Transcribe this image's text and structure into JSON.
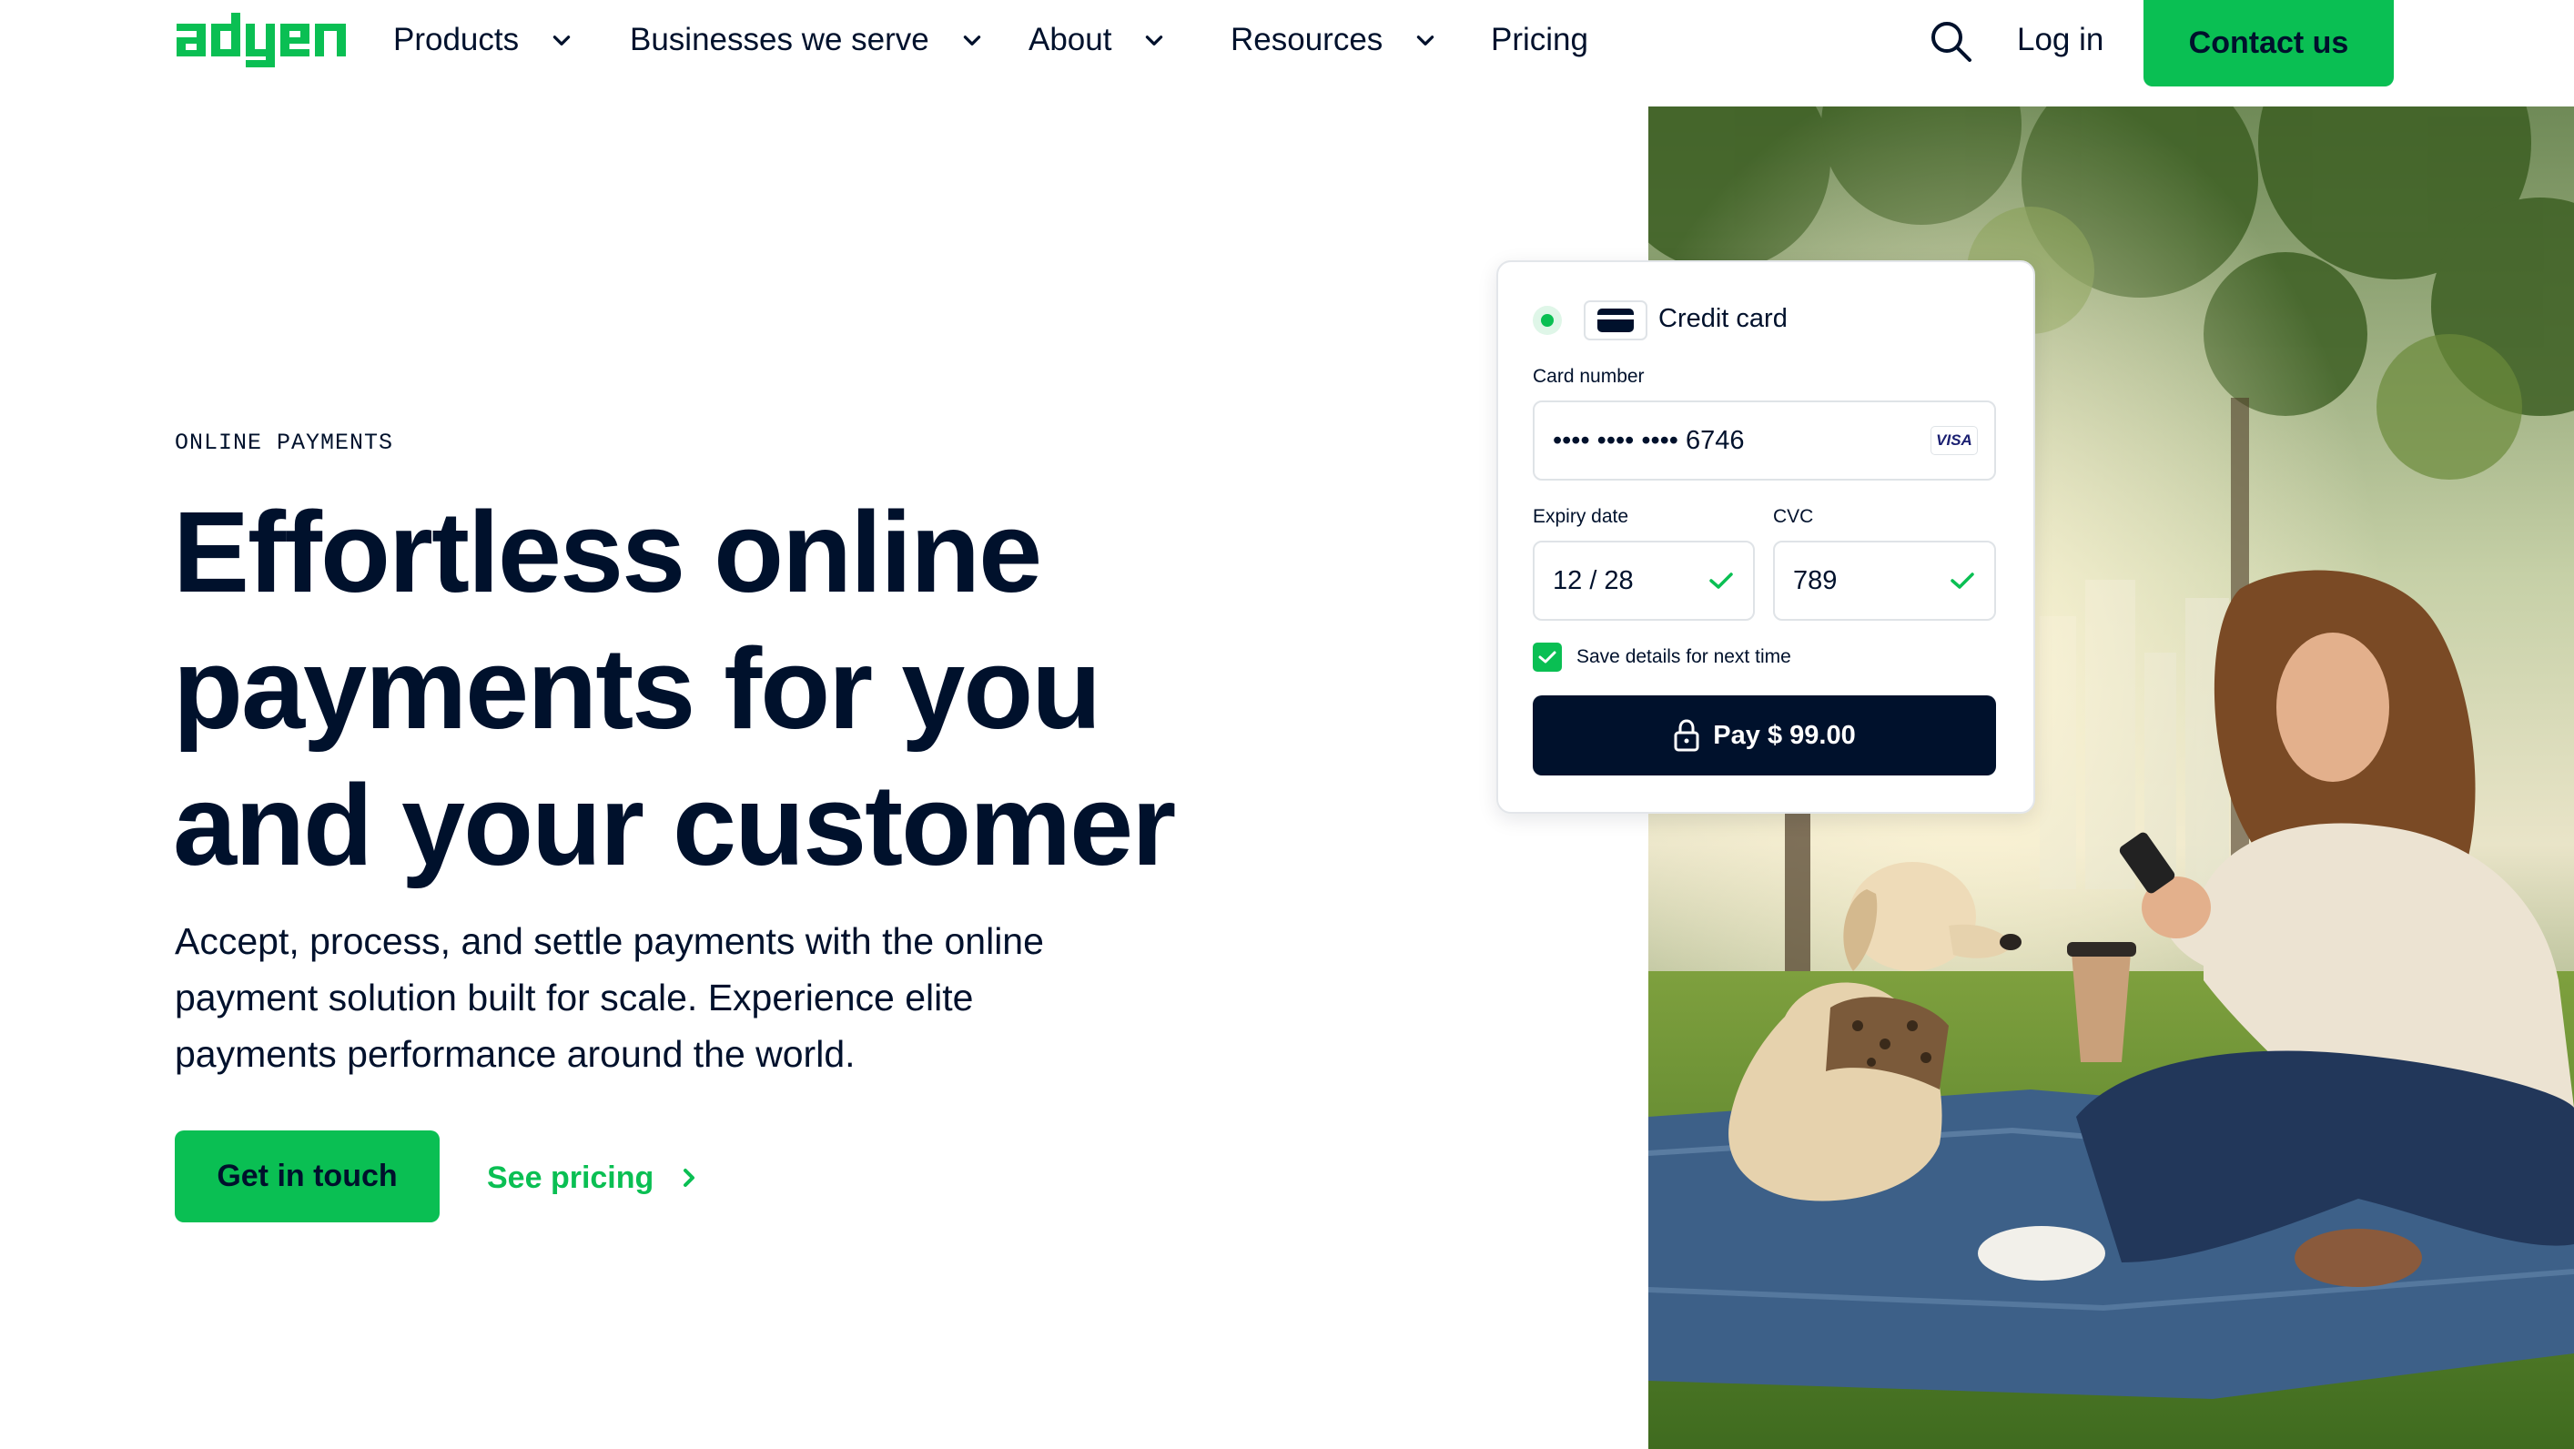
{
  "nav": {
    "logo_text": "adyen",
    "items": [
      {
        "label": "Products",
        "has_dropdown": true
      },
      {
        "label": "Businesses we serve",
        "has_dropdown": true
      },
      {
        "label": "About",
        "has_dropdown": true
      },
      {
        "label": "Resources",
        "has_dropdown": true
      },
      {
        "label": "Pricing",
        "has_dropdown": false
      }
    ],
    "search_icon": "search-icon",
    "login_label": "Log in",
    "contact_label": "Contact us"
  },
  "hero": {
    "eyebrow": "ONLINE PAYMENTS",
    "title_lines": [
      "Effortless online",
      "payments for you",
      "and your customer"
    ],
    "description_lines": [
      "Accept, process, and settle payments with the online",
      "payment solution built for scale. Experience elite",
      "payments performance around the world."
    ],
    "primary_cta": "Get in touch",
    "secondary_cta": "See pricing"
  },
  "payment_card": {
    "method_label": "Credit card",
    "card_number_label": "Card number",
    "card_number_value": "•••• •••• •••• 6746",
    "card_brand": "VISA",
    "expiry_label": "Expiry date",
    "expiry_value": "12 / 28",
    "cvc_label": "CVC",
    "cvc_value": "789",
    "save_label": "Save details for next time",
    "save_checked": true,
    "pay_label": "Pay $ 99.00"
  },
  "colors": {
    "brand_green": "#0abf53",
    "navy": "#00112c",
    "white": "#ffffff"
  }
}
